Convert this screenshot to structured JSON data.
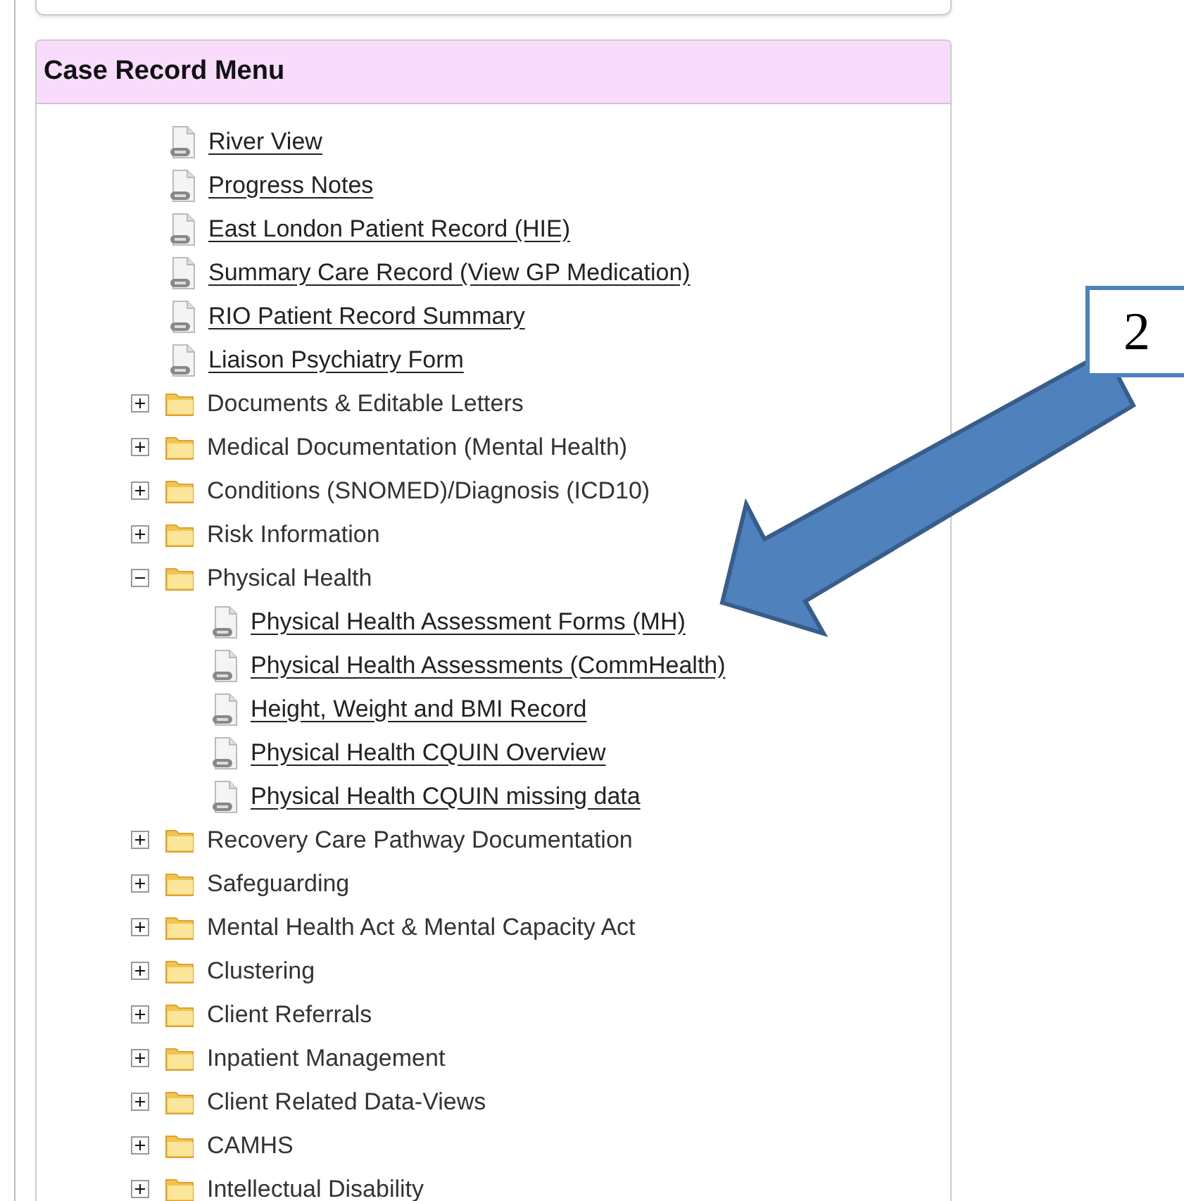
{
  "menu": {
    "title": "Case Record Menu",
    "items": [
      {
        "kind": "link",
        "label": "River View"
      },
      {
        "kind": "link",
        "label": "Progress Notes"
      },
      {
        "kind": "link",
        "label": "East London Patient Record (HIE)"
      },
      {
        "kind": "link",
        "label": "Summary Care Record (View GP Medication)"
      },
      {
        "kind": "link",
        "label": "RIO Patient Record Summary"
      },
      {
        "kind": "link",
        "label": "Liaison Psychiatry Form"
      },
      {
        "kind": "folder",
        "label": "Documents & Editable Letters",
        "expanded": false
      },
      {
        "kind": "folder",
        "label": "Medical Documentation (Mental Health)",
        "expanded": false
      },
      {
        "kind": "folder",
        "label": "Conditions (SNOMED)/Diagnosis (ICD10)",
        "expanded": false
      },
      {
        "kind": "folder",
        "label": "Risk Information",
        "expanded": false
      },
      {
        "kind": "folder",
        "label": "Physical Health",
        "expanded": true,
        "children": [
          {
            "kind": "link",
            "label": "Physical Health Assessment Forms (MH)"
          },
          {
            "kind": "link",
            "label": "Physical Health Assessments (CommHealth)"
          },
          {
            "kind": "link",
            "label": "Height, Weight and BMI Record"
          },
          {
            "kind": "link",
            "label": "Physical Health CQUIN Overview"
          },
          {
            "kind": "link",
            "label": "Physical Health CQUIN missing data"
          }
        ]
      },
      {
        "kind": "folder",
        "label": "Recovery Care Pathway Documentation",
        "expanded": false
      },
      {
        "kind": "folder",
        "label": "Safeguarding",
        "expanded": false
      },
      {
        "kind": "folder",
        "label": "Mental Health Act & Mental Capacity Act",
        "expanded": false
      },
      {
        "kind": "folder",
        "label": "Clustering",
        "expanded": false
      },
      {
        "kind": "folder",
        "label": "Client Referrals",
        "expanded": false
      },
      {
        "kind": "folder",
        "label": "Inpatient Management",
        "expanded": false
      },
      {
        "kind": "folder",
        "label": "Client Related Data-Views",
        "expanded": false
      },
      {
        "kind": "folder",
        "label": "CAMHS",
        "expanded": false
      },
      {
        "kind": "folder",
        "label": "Intellectual Disability",
        "expanded": false
      }
    ]
  },
  "callout": {
    "label": "2"
  }
}
